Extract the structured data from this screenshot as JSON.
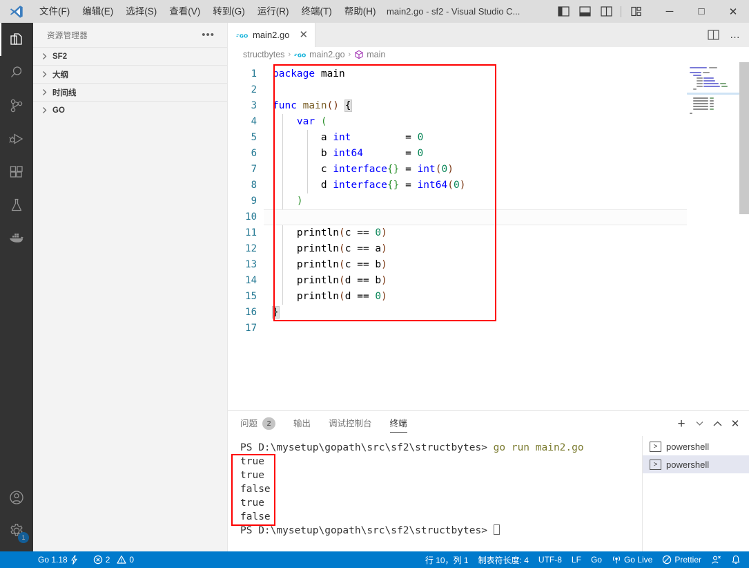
{
  "titlebar": {
    "logo_icon": "vscode-logo-icon",
    "menus": [
      {
        "label": "文件(F)",
        "name": "menu-file"
      },
      {
        "label": "编辑(E)",
        "name": "menu-edit"
      },
      {
        "label": "选择(S)",
        "name": "menu-selection"
      },
      {
        "label": "查看(V)",
        "name": "menu-view"
      },
      {
        "label": "转到(G)",
        "name": "menu-go"
      },
      {
        "label": "运行(R)",
        "name": "menu-run"
      },
      {
        "label": "终端(T)",
        "name": "menu-terminal"
      },
      {
        "label": "帮助(H)",
        "name": "menu-help"
      }
    ],
    "window_title": "main2.go - sf2 - Visual Studio C...",
    "layout_buttons": [
      {
        "name": "toggle-primary-sidebar-icon",
        "title": "切换主侧栏"
      },
      {
        "name": "toggle-panel-icon",
        "title": "切换面板"
      },
      {
        "name": "toggle-secondary-sidebar-icon",
        "title": "切换辅助侧栏"
      },
      {
        "name": "customize-layout-icon",
        "title": "自定义布局"
      }
    ],
    "window_controls": [
      {
        "name": "minimize-button",
        "glyph": "─"
      },
      {
        "name": "maximize-button",
        "glyph": "□"
      },
      {
        "name": "close-button",
        "glyph": "✕"
      }
    ]
  },
  "activitybar": {
    "items": [
      {
        "name": "activity-explorer",
        "icon": "files-icon",
        "active": true
      },
      {
        "name": "activity-search",
        "icon": "search-icon",
        "active": false
      },
      {
        "name": "activity-source-control",
        "icon": "source-control-icon",
        "active": false
      },
      {
        "name": "activity-run-debug",
        "icon": "run-debug-icon",
        "active": false
      },
      {
        "name": "activity-extensions",
        "icon": "extensions-icon",
        "active": false
      },
      {
        "name": "activity-testing",
        "icon": "beaker-icon",
        "active": false
      },
      {
        "name": "activity-docker",
        "icon": "docker-whale-icon",
        "active": false
      }
    ],
    "bottom": [
      {
        "name": "activity-accounts",
        "icon": "account-icon"
      },
      {
        "name": "activity-settings",
        "icon": "gear-icon",
        "badge": "1"
      }
    ]
  },
  "sidebar": {
    "title": "资源管理器",
    "more_actions": "•••",
    "sections": [
      {
        "label": "SF2",
        "name": "sidebar-section-sf2",
        "expanded": false
      },
      {
        "label": "大纲",
        "name": "sidebar-section-outline",
        "expanded": false
      },
      {
        "label": "时间线",
        "name": "sidebar-section-timeline",
        "expanded": false
      },
      {
        "label": "GO",
        "name": "sidebar-section-go",
        "expanded": false
      }
    ]
  },
  "editor": {
    "tab": {
      "label": "main2.go",
      "icon": "go-file-icon",
      "close": "✕"
    },
    "actions": [
      {
        "name": "split-editor-right-icon"
      },
      {
        "name": "more-editor-actions-icon",
        "glyph": "…"
      }
    ],
    "breadcrumb": [
      {
        "label": "structbytes",
        "icon": "folder"
      },
      {
        "label": "main2.go",
        "icon": "go-file-icon"
      },
      {
        "label": "main",
        "icon": "symbol-package-icon"
      }
    ],
    "breadcrumb_separator": "›",
    "line_numbers": [
      "1",
      "2",
      "3",
      "4",
      "5",
      "6",
      "7",
      "8",
      "9",
      "10",
      "11",
      "12",
      "13",
      "14",
      "15",
      "16",
      "17"
    ],
    "code": [
      "package main",
      "",
      "func main() {",
      "    var (",
      "        a int         = 0",
      "        b int64       = 0",
      "        c interface{} = int(0)",
      "        d interface{} = int64(0)",
      "    )",
      "",
      "    println(c == 0)",
      "    println(c == a)",
      "    println(c == b)",
      "    println(d == b)",
      "    println(d == 0)",
      "}",
      ""
    ],
    "current_line": 10,
    "highlight_box": {
      "color": "#fe0000",
      "around": "code-lines-1-16"
    }
  },
  "panel": {
    "tabs": [
      {
        "label": "问题",
        "name": "panel-tab-problems",
        "badge": "2",
        "active": false
      },
      {
        "label": "输出",
        "name": "panel-tab-output",
        "active": false
      },
      {
        "label": "调试控制台",
        "name": "panel-tab-debug-console",
        "active": false
      },
      {
        "label": "终端",
        "name": "panel-tab-terminal",
        "active": true
      }
    ],
    "actions": [
      {
        "name": "new-terminal-icon",
        "glyph": "+"
      },
      {
        "name": "terminal-dropdown-icon",
        "glyph": "⌄"
      },
      {
        "name": "maximize-panel-icon",
        "glyph": "⌃"
      },
      {
        "name": "close-panel-icon",
        "glyph": "✕"
      }
    ],
    "terminal": {
      "prompt": "PS D:\\mysetup\\gopath\\src\\sf2\\structbytes>",
      "command": "go run main2.go",
      "output": [
        "true",
        "true",
        "false",
        "true",
        "false"
      ],
      "prompt2": "PS D:\\mysetup\\gopath\\src\\sf2\\structbytes>",
      "cursor": "█",
      "highlight_box": {
        "color": "#fe0000",
        "around": "terminal-output"
      }
    },
    "terminal_list": [
      {
        "label": "powershell",
        "name": "terminal-list-item-1",
        "selected": false
      },
      {
        "label": "powershell",
        "name": "terminal-list-item-2",
        "selected": true
      }
    ]
  },
  "statusbar": {
    "left": [
      {
        "label": "Go 1.18",
        "name": "status-go-version",
        "icon": "lightning-icon"
      },
      {
        "label": "2",
        "name": "status-errors",
        "icon": "error-circle-icon"
      },
      {
        "label": "0",
        "name": "status-warnings",
        "icon": "warning-triangle-icon"
      }
    ],
    "right": [
      {
        "label": "行 10，列 1",
        "name": "status-cursor-position"
      },
      {
        "label": "制表符长度: 4",
        "name": "status-indentation"
      },
      {
        "label": "UTF-8",
        "name": "status-encoding"
      },
      {
        "label": "LF",
        "name": "status-eol"
      },
      {
        "label": "Go",
        "name": "status-language-mode"
      },
      {
        "label": "Go Live",
        "name": "status-go-live",
        "icon": "broadcast-icon"
      },
      {
        "label": "Prettier",
        "name": "status-prettier",
        "icon": "prohibited-icon"
      },
      {
        "label": "",
        "name": "status-remote",
        "icon": "feedback-icon"
      },
      {
        "label": "",
        "name": "status-notifications",
        "icon": "bell-icon"
      }
    ]
  },
  "colors": {
    "accent": "#007acc",
    "highlight_red": "#fe0000",
    "activitybar_bg": "#333333",
    "sidebar_bg": "#f3f3f3",
    "titlebar_bg": "#dddddd"
  }
}
